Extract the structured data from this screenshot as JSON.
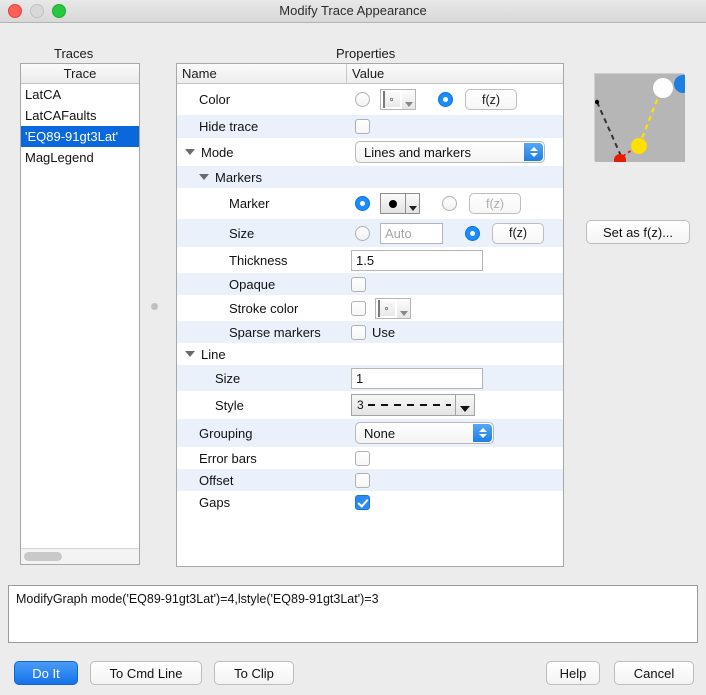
{
  "window": {
    "title": "Modify Trace Appearance",
    "traffic_lights": [
      "close",
      "minimize",
      "zoom"
    ]
  },
  "traces_panel": {
    "caption": "Traces",
    "column_header": "Trace",
    "items": [
      {
        "label": "LatCA",
        "selected": false
      },
      {
        "label": "LatCAFaults",
        "selected": false
      },
      {
        "label": "'EQ89-91gt3Lat'",
        "selected": true
      },
      {
        "label": "MagLegend",
        "selected": false
      }
    ]
  },
  "properties_panel": {
    "caption": "Properties",
    "columns": {
      "name": "Name",
      "value": "Value"
    },
    "rows": {
      "color": {
        "label": "Color",
        "radio_literal_on": false,
        "swatch_color": "#fa2600",
        "radio_fz_on": true,
        "fz_label": "f(z)"
      },
      "hide_trace": {
        "label": "Hide trace",
        "checked": false
      },
      "mode": {
        "label": "Mode",
        "expanded": true,
        "value": "Lines and markers"
      },
      "markers_group": {
        "label": "Markers",
        "expanded": true
      },
      "marker": {
        "label": "Marker",
        "radio_literal_on": true,
        "glyph": "filled-circle",
        "radio_fz_on": false,
        "fz_label": "f(z)"
      },
      "size_marker": {
        "label": "Size",
        "radio_literal_on": false,
        "field_placeholder": "Auto",
        "radio_fz_on": true,
        "fz_label": "f(z)"
      },
      "thickness": {
        "label": "Thickness",
        "value": "1.5"
      },
      "opaque": {
        "label": "Opaque",
        "checked": false
      },
      "stroke_color": {
        "label": "Stroke color",
        "checked": false,
        "swatch_color": "#000000"
      },
      "sparse_markers": {
        "label": "Sparse markers",
        "checked": false,
        "use_label": "Use"
      },
      "line_group": {
        "label": "Line",
        "expanded": true
      },
      "size_line": {
        "label": "Size",
        "value": "1"
      },
      "style": {
        "label": "Style",
        "value": "3",
        "dash_pattern": "dashed"
      },
      "grouping": {
        "label": "Grouping",
        "value": "None"
      },
      "error_bars": {
        "label": "Error bars",
        "checked": false
      },
      "offset": {
        "label": "Offset",
        "checked": false
      },
      "gaps": {
        "label": "Gaps",
        "checked": true
      }
    }
  },
  "preview_panel": {
    "background_color": "#b6b6b6",
    "set_as_fz_label": "Set as f(z)...",
    "markers": [
      {
        "name": "white-large-marker",
        "color": "#ffffff",
        "size": "large"
      },
      {
        "name": "blue-corner-marker",
        "color": "#1e7fe0",
        "size": "large"
      },
      {
        "name": "yellow-marker",
        "color": "#ffe000",
        "size": "medium"
      },
      {
        "name": "red-marker",
        "color": "#e81a00",
        "size": "small"
      },
      {
        "name": "black-dot-marker",
        "color": "#000000",
        "size": "tiny"
      }
    ],
    "lines": [
      {
        "name": "yellow-dashed-line",
        "color": "#ffe000"
      },
      {
        "name": "black-dashed-line",
        "color": "#333333"
      },
      {
        "name": "red-dashed-line",
        "color": "#e81a00"
      }
    ]
  },
  "command_area": {
    "text": "ModifyGraph mode('EQ89-91gt3Lat')=4,lstyle('EQ89-91gt3Lat')=3"
  },
  "bottom_bar": {
    "do_it": "Do It",
    "to_cmd_line": "To Cmd Line",
    "to_clip": "To Clip",
    "help": "Help",
    "cancel": "Cancel"
  },
  "colors": {
    "accent": "#1572e8",
    "selection": "#0a68dd",
    "row_alt": "#eaf1fb",
    "window_bg": "#ececec"
  }
}
